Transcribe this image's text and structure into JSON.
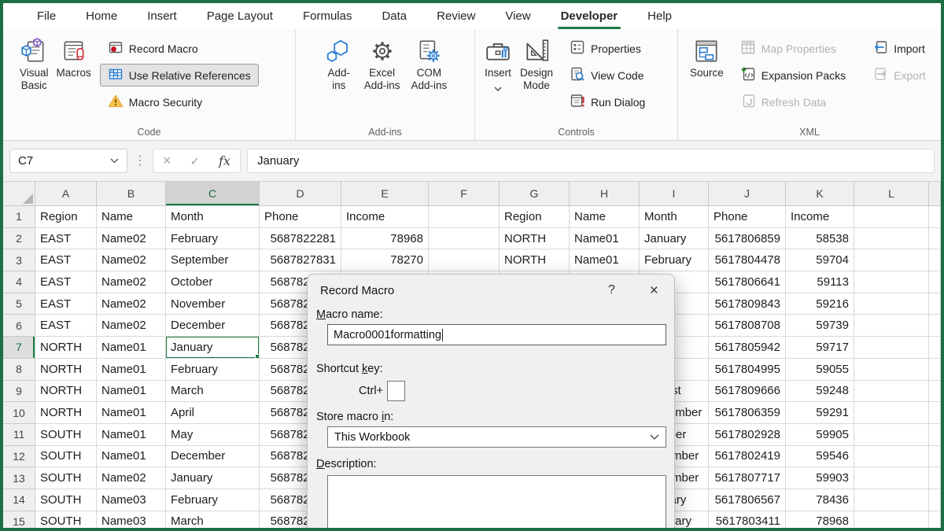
{
  "tabs": {
    "items": [
      "File",
      "Home",
      "Insert",
      "Page Layout",
      "Formulas",
      "Data",
      "Review",
      "View",
      "Developer",
      "Help"
    ],
    "active": "Developer"
  },
  "ribbon": {
    "code": {
      "caption": "Code",
      "visual_basic": [
        "Visual",
        "Basic"
      ],
      "macros": "Macros",
      "record_macro": "Record Macro",
      "use_relative_references": "Use Relative References",
      "macro_security": "Macro Security"
    },
    "addins": {
      "caption": "Add-ins",
      "add_ins": [
        "Add-",
        "ins"
      ],
      "excel_add_ins": [
        "Excel",
        "Add-ins"
      ],
      "com_add_ins": [
        "COM",
        "Add-ins"
      ]
    },
    "controls": {
      "caption": "Controls",
      "insert": "Insert",
      "design_mode": [
        "Design",
        "Mode"
      ],
      "properties": "Properties",
      "view_code": "View Code",
      "run_dialog": "Run Dialog"
    },
    "xml": {
      "caption": "XML",
      "source": "Source",
      "map_properties": "Map Properties",
      "expansion_packs": "Expansion Packs",
      "refresh_data": "Refresh Data",
      "import": "Import",
      "export": "Export"
    }
  },
  "formula_bar": {
    "name_box": "C7",
    "dots": "⋮",
    "cancel": "×",
    "commit": "✓",
    "fx": "fx",
    "value": "January"
  },
  "grid": {
    "column_headers": [
      "A",
      "B",
      "C",
      "D",
      "E",
      "F",
      "G",
      "H",
      "I",
      "J",
      "K",
      "L",
      ""
    ],
    "active_cell": {
      "column": "C",
      "row": 7,
      "col_index": 2,
      "value": "January"
    },
    "rows": [
      [
        "Region",
        "Name",
        "Month",
        "Phone",
        "Income",
        "",
        "Region",
        "Name",
        "Month",
        "Phone",
        "Income",
        "",
        ""
      ],
      [
        "EAST",
        "Name02",
        "February",
        "5687822281",
        "78968",
        "",
        "NORTH",
        "Name01",
        "January",
        "5617806859",
        "58538",
        "",
        ""
      ],
      [
        "EAST",
        "Name02",
        "September",
        "5687827831",
        "78270",
        "",
        "NORTH",
        "Name01",
        "February",
        "5617804478",
        "59704",
        "",
        ""
      ],
      [
        "EAST",
        "Name02",
        "October",
        "5687822281",
        "",
        "",
        "",
        "",
        "",
        "5617806641",
        "59113",
        "",
        ""
      ],
      [
        "EAST",
        "Name02",
        "November",
        "5687822281",
        "",
        "",
        "",
        "",
        "",
        "5617809843",
        "59216",
        "",
        ""
      ],
      [
        "EAST",
        "Name02",
        "December",
        "5687822281",
        "",
        "",
        "",
        "",
        "",
        "5617808708",
        "59739",
        "",
        ""
      ],
      [
        "NORTH",
        "Name01",
        "January",
        "5687822281",
        "",
        "",
        "",
        "",
        "",
        "5617805942",
        "59717",
        "",
        ""
      ],
      [
        "NORTH",
        "Name01",
        "February",
        "5687822281",
        "",
        "",
        "",
        "",
        "",
        "5617804995",
        "59055",
        "",
        ""
      ],
      [
        "NORTH",
        "Name01",
        "March",
        "5687822281",
        "",
        "",
        "",
        "",
        "August",
        "5617809666",
        "59248",
        "",
        ""
      ],
      [
        "NORTH",
        "Name01",
        "April",
        "5687822281",
        "",
        "",
        "",
        "",
        "September",
        "5617806359",
        "59291",
        "",
        ""
      ],
      [
        "SOUTH",
        "Name01",
        "May",
        "5687822281",
        "",
        "",
        "",
        "",
        "October",
        "5617802928",
        "59905",
        "",
        ""
      ],
      [
        "SOUTH",
        "Name01",
        "December",
        "5687822281",
        "",
        "",
        "",
        "",
        "November",
        "5617802419",
        "59546",
        "",
        ""
      ],
      [
        "SOUTH",
        "Name02",
        "January",
        "5687822281",
        "",
        "",
        "",
        "",
        "December",
        "5617807717",
        "59903",
        "",
        ""
      ],
      [
        "SOUTH",
        "Name03",
        "February",
        "5687822281",
        "",
        "",
        "",
        "",
        "January",
        "5617806567",
        "78436",
        "",
        ""
      ],
      [
        "SOUTH",
        "Name03",
        "March",
        "5687822281",
        "",
        "",
        "",
        "",
        "February",
        "5617803411",
        "78968",
        "",
        ""
      ]
    ]
  },
  "dialog": {
    "title": "Record Macro",
    "help": "?",
    "close": "×",
    "macro_name": {
      "pre": "",
      "key": "M",
      "post": "acro name:",
      "value": "Macro0001formatting"
    },
    "shortcut_key": {
      "pre": "Shortcut ",
      "key": "k",
      "post": "ey:",
      "ctrl": "Ctrl+",
      "value": ""
    },
    "store_macro_in": {
      "pre": "Store macro ",
      "key": "i",
      "post": "n:",
      "value": "This Workbook"
    },
    "description": {
      "pre": "",
      "key": "D",
      "post": "escription:",
      "value": ""
    }
  }
}
